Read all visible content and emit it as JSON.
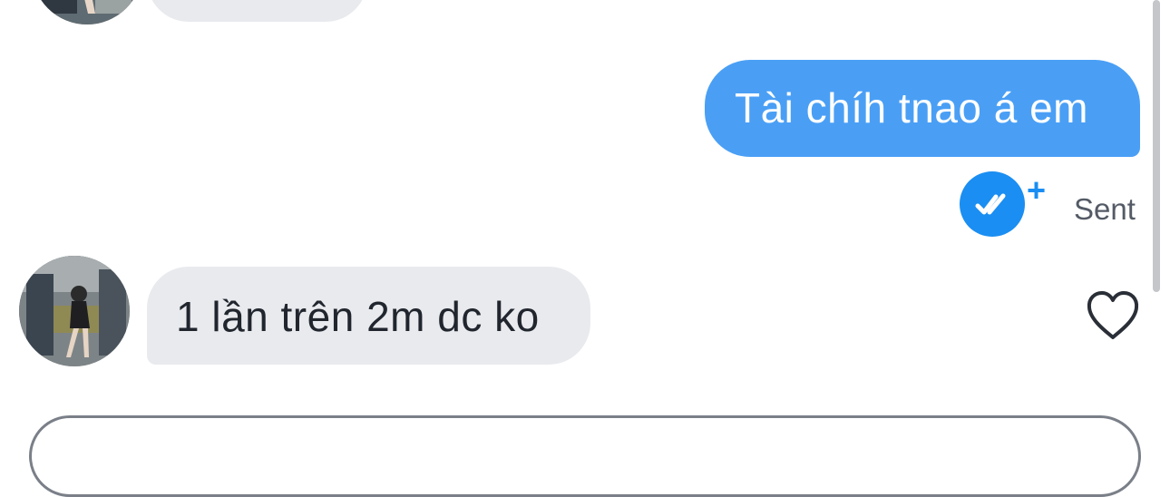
{
  "conversation": {
    "messages": [
      {
        "direction": "received",
        "text": ""
      },
      {
        "direction": "sent",
        "text": "Tài chíh tnao á em"
      },
      {
        "direction": "received",
        "text": "1 lần trên 2m dc ko"
      }
    ],
    "status": {
      "seen_icon": "double-check-icon",
      "plus_label": "+",
      "label": "Sent"
    },
    "like_icon": "heart-outline-icon"
  },
  "composer": {
    "placeholder": ""
  },
  "colors": {
    "sent_bubble": "#4a9ff5",
    "received_bubble": "#e9eaee",
    "accent": "#1a8ef2",
    "status_text": "#545b66"
  }
}
